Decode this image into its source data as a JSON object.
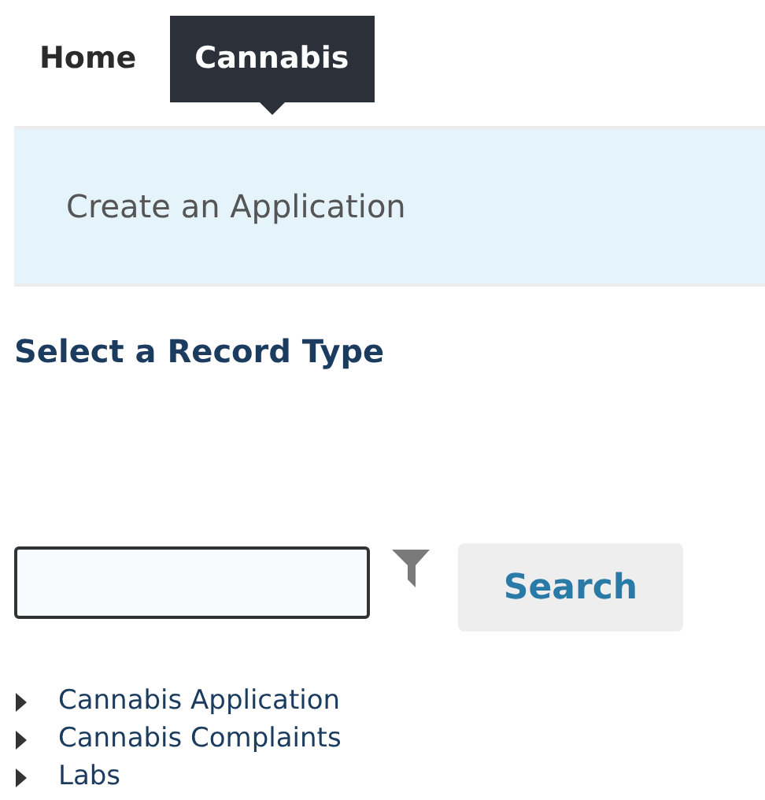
{
  "tabs": [
    {
      "label": "Home",
      "selected": false
    },
    {
      "label": "Cannabis",
      "selected": true
    }
  ],
  "banner": {
    "title": "Create an Application"
  },
  "heading": "Select a Record Type",
  "search": {
    "button": "Search"
  },
  "record_types": [
    {
      "label": "Cannabis Application",
      "expanded": false
    },
    {
      "label": "Cannabis Complaints",
      "expanded": false
    },
    {
      "label": "Labs",
      "expanded": false
    }
  ]
}
